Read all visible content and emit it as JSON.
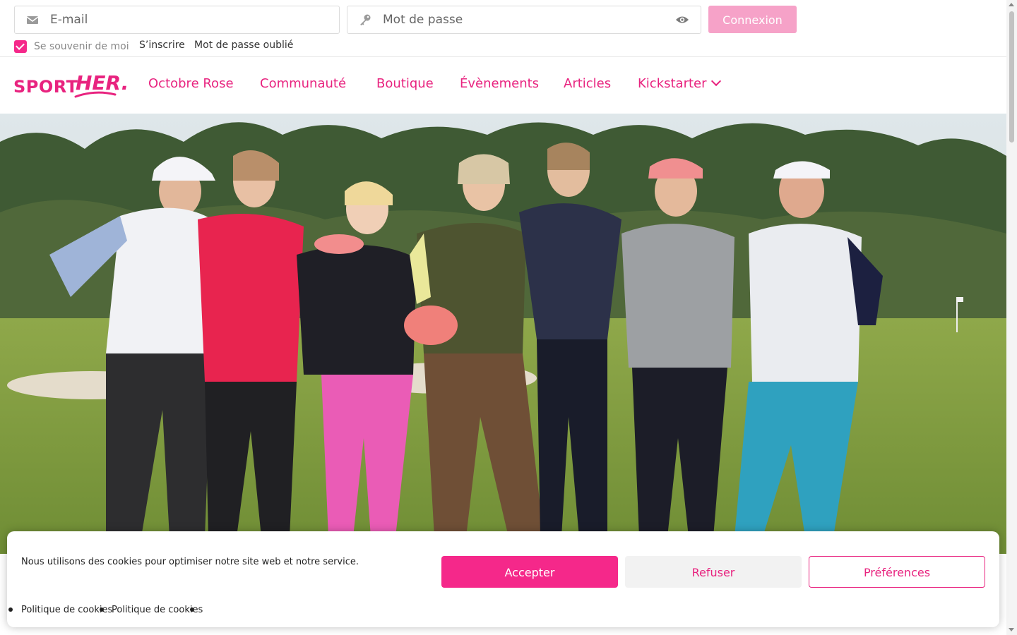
{
  "login": {
    "email_placeholder": "E-mail",
    "password_placeholder": "Mot de passe",
    "submit_label": "Connexion",
    "remember_label": "Se souvenir de moi",
    "remember_checked": true,
    "signup_label": "S’inscrire",
    "forgot_label": "Mot de passe oublié"
  },
  "brand": {
    "logo_part1": "SPORT",
    "logo_part2": "HER.",
    "color_primary": "#e8237f",
    "color_button_light": "#f6a2c8"
  },
  "nav": {
    "items": [
      {
        "label": "Octobre Rose"
      },
      {
        "label": "Communauté"
      },
      {
        "label": "Boutique"
      },
      {
        "label": "Évènements"
      },
      {
        "label": "Articles"
      },
      {
        "label": "Kickstarter",
        "icon": "chevron-down-icon"
      }
    ]
  },
  "hero": {
    "image": "photo of seven women golfers standing arm in arm on a golf course"
  },
  "cookie": {
    "message": "Nous utilisons des cookies pour optimiser notre site web et notre service.",
    "accept_label": "Accepter",
    "refuse_label": "Refuser",
    "prefs_label": "Préférences",
    "links": [
      "Politique de cookies",
      "Politique de cookies"
    ]
  }
}
